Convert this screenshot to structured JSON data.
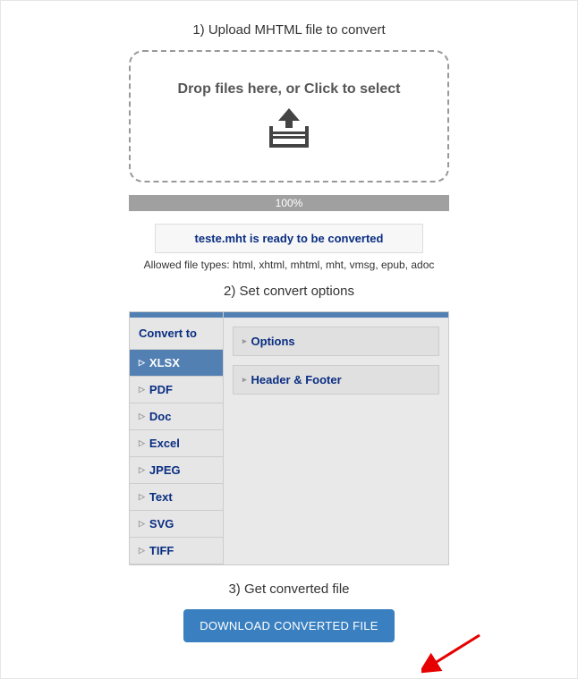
{
  "step1": {
    "heading": "1) Upload MHTML file to convert",
    "dropzone_text": "Drop files here, or Click to select",
    "progress_text": "100%",
    "ready_text": "teste.mht is ready to be converted",
    "allowed_text": "Allowed file types: html, xhtml, mhtml, mht, vmsg, epub, adoc"
  },
  "step2": {
    "heading": "2) Set convert options",
    "sidebar_title": "Convert to",
    "formats": [
      {
        "label": "XLSX",
        "active": true
      },
      {
        "label": "PDF",
        "active": false
      },
      {
        "label": "Doc",
        "active": false
      },
      {
        "label": "Excel",
        "active": false
      },
      {
        "label": "JPEG",
        "active": false
      },
      {
        "label": "Text",
        "active": false
      },
      {
        "label": "SVG",
        "active": false
      },
      {
        "label": "TIFF",
        "active": false
      }
    ],
    "accordions": [
      {
        "label": "Options"
      },
      {
        "label": "Header & Footer"
      }
    ]
  },
  "step3": {
    "heading": "3) Get converted file",
    "button_label": "DOWNLOAD CONVERTED FILE"
  }
}
